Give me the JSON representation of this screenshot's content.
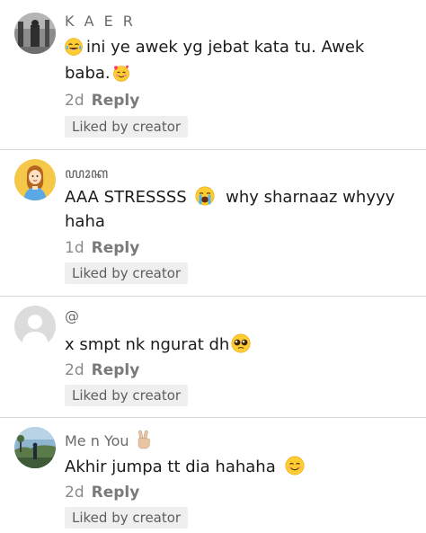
{
  "comments": [
    {
      "username": "K A E R",
      "lines": [
        "ini ye awek yg jebat kata tu. Awek",
        "baba."
      ],
      "time": "2d",
      "reply": "Reply",
      "badge": "Liked by creator",
      "avatar": "profile-photo"
    },
    {
      "username": "ꦪꦴꦏ",
      "lines": [
        "AAA STRESSSS",
        "why sharnaaz whyyy",
        "haha"
      ],
      "time": "1d",
      "reply": "Reply",
      "badge": "Liked by creator",
      "avatar": "cartoon-princess"
    },
    {
      "username": "@",
      "lines": [
        "x smpt nk ngurat dh"
      ],
      "time": "2d",
      "reply": "Reply",
      "badge": "Liked by creator",
      "avatar": "default-person"
    },
    {
      "username": "Me n You",
      "lines": [
        "Akhir jumpa tt dia hahaha"
      ],
      "time": "2d",
      "reply": "Reply",
      "badge": "Liked by creator",
      "avatar": "landscape-photo"
    }
  ],
  "icons": {
    "c1_lead": "face-with-tears-of-joy-icon",
    "c1_trail": "smiling-face-with-hearts-icon",
    "c2": "loudly-crying-face-icon",
    "c3": "pleading-face-icon",
    "c4_name": "victory-hand-icon",
    "c4": "smiling-face-icon"
  },
  "colors": {
    "text": "#1b1b1b",
    "username": "#6b6b6b",
    "meta": "#8a8a8a",
    "badge_bg": "#efefef",
    "divider": "#d7d7d7"
  }
}
